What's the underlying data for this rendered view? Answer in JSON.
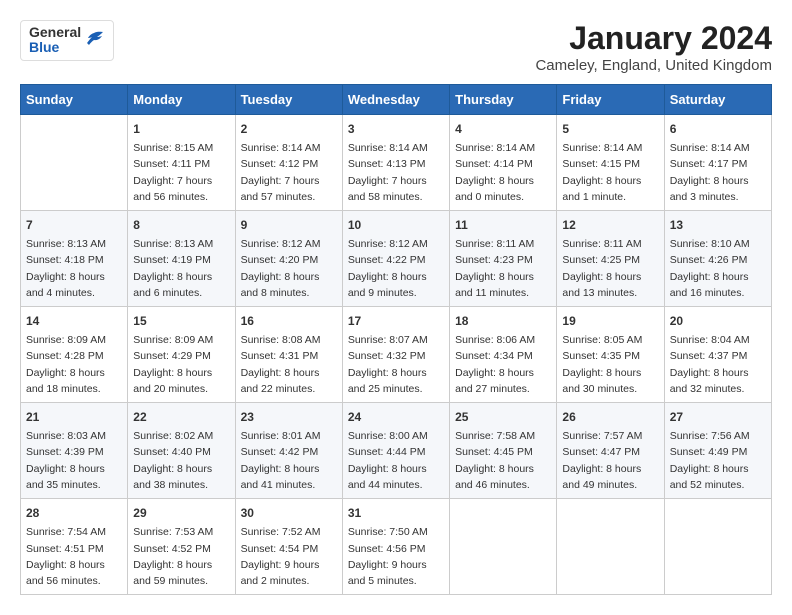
{
  "logo": {
    "general": "General",
    "blue": "Blue"
  },
  "title": "January 2024",
  "subtitle": "Cameley, England, United Kingdom",
  "days_header": [
    "Sunday",
    "Monday",
    "Tuesday",
    "Wednesday",
    "Thursday",
    "Friday",
    "Saturday"
  ],
  "weeks": [
    [
      {
        "day": "",
        "info": ""
      },
      {
        "day": "1",
        "info": "Sunrise: 8:15 AM\nSunset: 4:11 PM\nDaylight: 7 hours\nand 56 minutes."
      },
      {
        "day": "2",
        "info": "Sunrise: 8:14 AM\nSunset: 4:12 PM\nDaylight: 7 hours\nand 57 minutes."
      },
      {
        "day": "3",
        "info": "Sunrise: 8:14 AM\nSunset: 4:13 PM\nDaylight: 7 hours\nand 58 minutes."
      },
      {
        "day": "4",
        "info": "Sunrise: 8:14 AM\nSunset: 4:14 PM\nDaylight: 8 hours\nand 0 minutes."
      },
      {
        "day": "5",
        "info": "Sunrise: 8:14 AM\nSunset: 4:15 PM\nDaylight: 8 hours\nand 1 minute."
      },
      {
        "day": "6",
        "info": "Sunrise: 8:14 AM\nSunset: 4:17 PM\nDaylight: 8 hours\nand 3 minutes."
      }
    ],
    [
      {
        "day": "7",
        "info": "Sunrise: 8:13 AM\nSunset: 4:18 PM\nDaylight: 8 hours\nand 4 minutes."
      },
      {
        "day": "8",
        "info": "Sunrise: 8:13 AM\nSunset: 4:19 PM\nDaylight: 8 hours\nand 6 minutes."
      },
      {
        "day": "9",
        "info": "Sunrise: 8:12 AM\nSunset: 4:20 PM\nDaylight: 8 hours\nand 8 minutes."
      },
      {
        "day": "10",
        "info": "Sunrise: 8:12 AM\nSunset: 4:22 PM\nDaylight: 8 hours\nand 9 minutes."
      },
      {
        "day": "11",
        "info": "Sunrise: 8:11 AM\nSunset: 4:23 PM\nDaylight: 8 hours\nand 11 minutes."
      },
      {
        "day": "12",
        "info": "Sunrise: 8:11 AM\nSunset: 4:25 PM\nDaylight: 8 hours\nand 13 minutes."
      },
      {
        "day": "13",
        "info": "Sunrise: 8:10 AM\nSunset: 4:26 PM\nDaylight: 8 hours\nand 16 minutes."
      }
    ],
    [
      {
        "day": "14",
        "info": "Sunrise: 8:09 AM\nSunset: 4:28 PM\nDaylight: 8 hours\nand 18 minutes."
      },
      {
        "day": "15",
        "info": "Sunrise: 8:09 AM\nSunset: 4:29 PM\nDaylight: 8 hours\nand 20 minutes."
      },
      {
        "day": "16",
        "info": "Sunrise: 8:08 AM\nSunset: 4:31 PM\nDaylight: 8 hours\nand 22 minutes."
      },
      {
        "day": "17",
        "info": "Sunrise: 8:07 AM\nSunset: 4:32 PM\nDaylight: 8 hours\nand 25 minutes."
      },
      {
        "day": "18",
        "info": "Sunrise: 8:06 AM\nSunset: 4:34 PM\nDaylight: 8 hours\nand 27 minutes."
      },
      {
        "day": "19",
        "info": "Sunrise: 8:05 AM\nSunset: 4:35 PM\nDaylight: 8 hours\nand 30 minutes."
      },
      {
        "day": "20",
        "info": "Sunrise: 8:04 AM\nSunset: 4:37 PM\nDaylight: 8 hours\nand 32 minutes."
      }
    ],
    [
      {
        "day": "21",
        "info": "Sunrise: 8:03 AM\nSunset: 4:39 PM\nDaylight: 8 hours\nand 35 minutes."
      },
      {
        "day": "22",
        "info": "Sunrise: 8:02 AM\nSunset: 4:40 PM\nDaylight: 8 hours\nand 38 minutes."
      },
      {
        "day": "23",
        "info": "Sunrise: 8:01 AM\nSunset: 4:42 PM\nDaylight: 8 hours\nand 41 minutes."
      },
      {
        "day": "24",
        "info": "Sunrise: 8:00 AM\nSunset: 4:44 PM\nDaylight: 8 hours\nand 44 minutes."
      },
      {
        "day": "25",
        "info": "Sunrise: 7:58 AM\nSunset: 4:45 PM\nDaylight: 8 hours\nand 46 minutes."
      },
      {
        "day": "26",
        "info": "Sunrise: 7:57 AM\nSunset: 4:47 PM\nDaylight: 8 hours\nand 49 minutes."
      },
      {
        "day": "27",
        "info": "Sunrise: 7:56 AM\nSunset: 4:49 PM\nDaylight: 8 hours\nand 52 minutes."
      }
    ],
    [
      {
        "day": "28",
        "info": "Sunrise: 7:54 AM\nSunset: 4:51 PM\nDaylight: 8 hours\nand 56 minutes."
      },
      {
        "day": "29",
        "info": "Sunrise: 7:53 AM\nSunset: 4:52 PM\nDaylight: 8 hours\nand 59 minutes."
      },
      {
        "day": "30",
        "info": "Sunrise: 7:52 AM\nSunset: 4:54 PM\nDaylight: 9 hours\nand 2 minutes."
      },
      {
        "day": "31",
        "info": "Sunrise: 7:50 AM\nSunset: 4:56 PM\nDaylight: 9 hours\nand 5 minutes."
      },
      {
        "day": "",
        "info": ""
      },
      {
        "day": "",
        "info": ""
      },
      {
        "day": "",
        "info": ""
      }
    ]
  ]
}
